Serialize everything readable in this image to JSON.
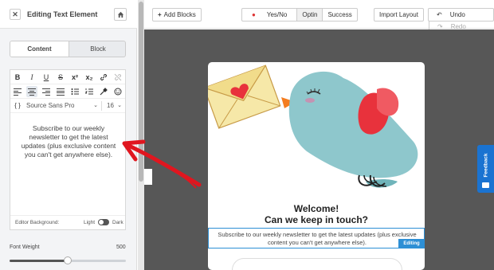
{
  "sidebar": {
    "title": "Editing Text Element",
    "tabs": [
      {
        "label": "Content",
        "active": true
      },
      {
        "label": "Block",
        "active": false
      }
    ],
    "toolbar": {
      "bold": "B",
      "italic": "I",
      "underline": "U",
      "strike": "S",
      "superscript": "x²",
      "subscript": "x₂",
      "custom_tag": "{ }",
      "font_family": "Source Sans Pro",
      "font_size": "16"
    },
    "editor_text": "Subscribe to our weekly newsletter to get the latest updates (plus exclusive content you can't get anywhere else).",
    "editor_background": {
      "label": "Editor Background:",
      "light": "Light",
      "dark": "Dark"
    },
    "font_weight": {
      "label": "Font Weight",
      "value": "500",
      "fraction": 0.5
    }
  },
  "topbar": {
    "add_blocks": "Add Blocks",
    "views": [
      {
        "label": "Yes/No",
        "active": false
      },
      {
        "label": "Optin",
        "active": true
      },
      {
        "label": "Success",
        "active": false
      }
    ],
    "import_layout": "Import Layout",
    "undo": "Undo",
    "redo": "Redo"
  },
  "popup": {
    "title_line1": "Welcome!",
    "title_line2": "Can we keep in touch?",
    "body": "Subscribe to our weekly newsletter to get the latest updates (plus exclusive content you can't get anywhere else).",
    "editing_badge": "Editing"
  },
  "feedback_tab": "Feedback",
  "colors": {
    "accent_blue": "#2d8fd5",
    "feedback_blue": "#1a73d1",
    "canvas_bg": "#575757",
    "bird_body": "#8ec7cc",
    "bird_wing": "#e8323c",
    "beak": "#f47d20",
    "envelope": "#f6e8a8",
    "arrow_red": "#e0161f"
  }
}
